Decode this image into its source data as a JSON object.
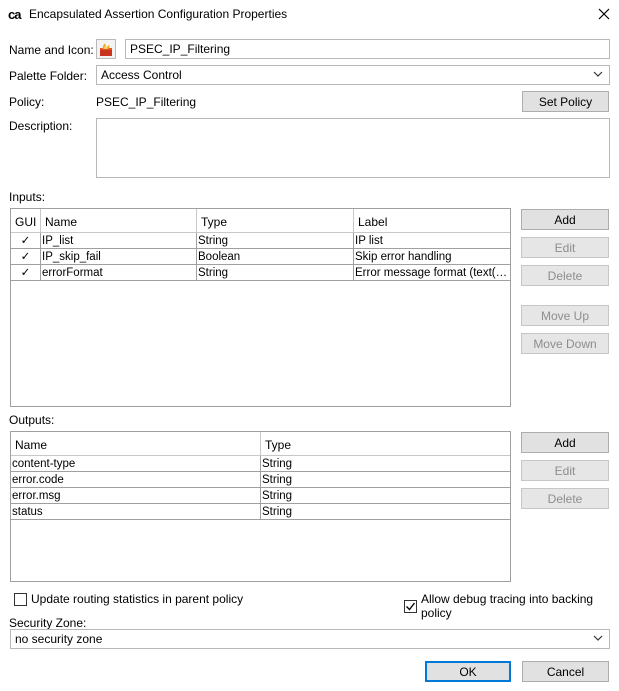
{
  "window": {
    "app_logo": "ca",
    "title": "Encapsulated Assertion Configuration Properties",
    "close_glyph": "✕"
  },
  "name_icon": {
    "label": "Name and Icon:",
    "value": "PSEC_IP_Filtering"
  },
  "palette_folder": {
    "label": "Palette Folder:",
    "value": "Access Control"
  },
  "policy": {
    "label": "Policy:",
    "value": "PSEC_IP_Filtering",
    "set_button": "Set Policy"
  },
  "description": {
    "label": "Description:",
    "value": ""
  },
  "inputs": {
    "label": "Inputs:",
    "columns": [
      "GUI",
      "Name",
      "Type",
      "Label"
    ],
    "rows": [
      {
        "gui": "✓",
        "name": "IP_list",
        "type": "String",
        "label": "IP list"
      },
      {
        "gui": "✓",
        "name": "IP_skip_fail",
        "type": "Boolean",
        "label": "Skip error handling"
      },
      {
        "gui": "✓",
        "name": "errorFormat",
        "type": "String",
        "label": "Error message format (text(d..."
      }
    ],
    "buttons": {
      "add": "Add",
      "edit": "Edit",
      "delete": "Delete",
      "move_up": "Move Up",
      "move_down": "Move Down"
    }
  },
  "outputs": {
    "label": "Outputs:",
    "columns": [
      "Name",
      "Type"
    ],
    "rows": [
      {
        "name": "content-type",
        "type": "String"
      },
      {
        "name": "error.code",
        "type": "String"
      },
      {
        "name": "error.msg",
        "type": "String"
      },
      {
        "name": "status",
        "type": "String"
      }
    ],
    "buttons": {
      "add": "Add",
      "edit": "Edit",
      "delete": "Delete"
    }
  },
  "options": {
    "update_routing": "Update routing statistics in parent policy",
    "update_routing_checked": false,
    "allow_debug": "Allow debug tracing into backing policy",
    "allow_debug_checked": true
  },
  "security_zone": {
    "label": "Security Zone:",
    "value": "no security zone"
  },
  "footer": {
    "ok": "OK",
    "cancel": "Cancel"
  }
}
